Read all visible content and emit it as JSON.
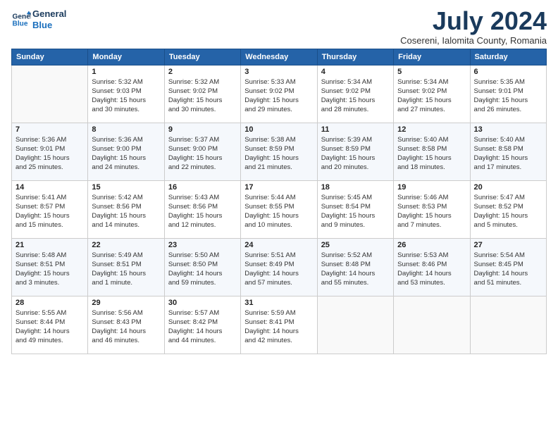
{
  "header": {
    "logo_line1": "General",
    "logo_line2": "Blue",
    "month": "July 2024",
    "location": "Cosereni, Ialomita County, Romania"
  },
  "weekdays": [
    "Sunday",
    "Monday",
    "Tuesday",
    "Wednesday",
    "Thursday",
    "Friday",
    "Saturday"
  ],
  "weeks": [
    [
      {
        "day": "",
        "info": ""
      },
      {
        "day": "1",
        "info": "Sunrise: 5:32 AM\nSunset: 9:03 PM\nDaylight: 15 hours\nand 30 minutes."
      },
      {
        "day": "2",
        "info": "Sunrise: 5:32 AM\nSunset: 9:02 PM\nDaylight: 15 hours\nand 30 minutes."
      },
      {
        "day": "3",
        "info": "Sunrise: 5:33 AM\nSunset: 9:02 PM\nDaylight: 15 hours\nand 29 minutes."
      },
      {
        "day": "4",
        "info": "Sunrise: 5:34 AM\nSunset: 9:02 PM\nDaylight: 15 hours\nand 28 minutes."
      },
      {
        "day": "5",
        "info": "Sunrise: 5:34 AM\nSunset: 9:02 PM\nDaylight: 15 hours\nand 27 minutes."
      },
      {
        "day": "6",
        "info": "Sunrise: 5:35 AM\nSunset: 9:01 PM\nDaylight: 15 hours\nand 26 minutes."
      }
    ],
    [
      {
        "day": "7",
        "info": "Sunrise: 5:36 AM\nSunset: 9:01 PM\nDaylight: 15 hours\nand 25 minutes."
      },
      {
        "day": "8",
        "info": "Sunrise: 5:36 AM\nSunset: 9:00 PM\nDaylight: 15 hours\nand 24 minutes."
      },
      {
        "day": "9",
        "info": "Sunrise: 5:37 AM\nSunset: 9:00 PM\nDaylight: 15 hours\nand 22 minutes."
      },
      {
        "day": "10",
        "info": "Sunrise: 5:38 AM\nSunset: 8:59 PM\nDaylight: 15 hours\nand 21 minutes."
      },
      {
        "day": "11",
        "info": "Sunrise: 5:39 AM\nSunset: 8:59 PM\nDaylight: 15 hours\nand 20 minutes."
      },
      {
        "day": "12",
        "info": "Sunrise: 5:40 AM\nSunset: 8:58 PM\nDaylight: 15 hours\nand 18 minutes."
      },
      {
        "day": "13",
        "info": "Sunrise: 5:40 AM\nSunset: 8:58 PM\nDaylight: 15 hours\nand 17 minutes."
      }
    ],
    [
      {
        "day": "14",
        "info": "Sunrise: 5:41 AM\nSunset: 8:57 PM\nDaylight: 15 hours\nand 15 minutes."
      },
      {
        "day": "15",
        "info": "Sunrise: 5:42 AM\nSunset: 8:56 PM\nDaylight: 15 hours\nand 14 minutes."
      },
      {
        "day": "16",
        "info": "Sunrise: 5:43 AM\nSunset: 8:56 PM\nDaylight: 15 hours\nand 12 minutes."
      },
      {
        "day": "17",
        "info": "Sunrise: 5:44 AM\nSunset: 8:55 PM\nDaylight: 15 hours\nand 10 minutes."
      },
      {
        "day": "18",
        "info": "Sunrise: 5:45 AM\nSunset: 8:54 PM\nDaylight: 15 hours\nand 9 minutes."
      },
      {
        "day": "19",
        "info": "Sunrise: 5:46 AM\nSunset: 8:53 PM\nDaylight: 15 hours\nand 7 minutes."
      },
      {
        "day": "20",
        "info": "Sunrise: 5:47 AM\nSunset: 8:52 PM\nDaylight: 15 hours\nand 5 minutes."
      }
    ],
    [
      {
        "day": "21",
        "info": "Sunrise: 5:48 AM\nSunset: 8:51 PM\nDaylight: 15 hours\nand 3 minutes."
      },
      {
        "day": "22",
        "info": "Sunrise: 5:49 AM\nSunset: 8:51 PM\nDaylight: 15 hours\nand 1 minute."
      },
      {
        "day": "23",
        "info": "Sunrise: 5:50 AM\nSunset: 8:50 PM\nDaylight: 14 hours\nand 59 minutes."
      },
      {
        "day": "24",
        "info": "Sunrise: 5:51 AM\nSunset: 8:49 PM\nDaylight: 14 hours\nand 57 minutes."
      },
      {
        "day": "25",
        "info": "Sunrise: 5:52 AM\nSunset: 8:48 PM\nDaylight: 14 hours\nand 55 minutes."
      },
      {
        "day": "26",
        "info": "Sunrise: 5:53 AM\nSunset: 8:46 PM\nDaylight: 14 hours\nand 53 minutes."
      },
      {
        "day": "27",
        "info": "Sunrise: 5:54 AM\nSunset: 8:45 PM\nDaylight: 14 hours\nand 51 minutes."
      }
    ],
    [
      {
        "day": "28",
        "info": "Sunrise: 5:55 AM\nSunset: 8:44 PM\nDaylight: 14 hours\nand 49 minutes."
      },
      {
        "day": "29",
        "info": "Sunrise: 5:56 AM\nSunset: 8:43 PM\nDaylight: 14 hours\nand 46 minutes."
      },
      {
        "day": "30",
        "info": "Sunrise: 5:57 AM\nSunset: 8:42 PM\nDaylight: 14 hours\nand 44 minutes."
      },
      {
        "day": "31",
        "info": "Sunrise: 5:59 AM\nSunset: 8:41 PM\nDaylight: 14 hours\nand 42 minutes."
      },
      {
        "day": "",
        "info": ""
      },
      {
        "day": "",
        "info": ""
      },
      {
        "day": "",
        "info": ""
      }
    ]
  ]
}
